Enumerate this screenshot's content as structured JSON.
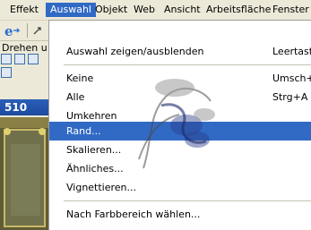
{
  "menubar": {
    "items": [
      {
        "label": "Effekt"
      },
      {
        "label": "Auswahl"
      },
      {
        "label": "Objekt"
      },
      {
        "label": "Web"
      },
      {
        "label": "Ansicht"
      },
      {
        "label": "Arbeitsfläche"
      },
      {
        "label": "Fenster"
      }
    ],
    "active": "Auswahl"
  },
  "toolbar": {
    "drehen_label": "Drehen u",
    "icons": [
      "ie-icon",
      "arrow-icon"
    ]
  },
  "document": {
    "title_fragment": "510"
  },
  "dropdown": {
    "items": [
      {
        "label": "Auswahl zeigen/ausblenden",
        "shortcut": "Leertaste"
      },
      {
        "label": "Keine",
        "shortcut": "Umsch+G"
      },
      {
        "label": "Alle",
        "shortcut": "Strg+A"
      },
      {
        "label": "Umkehren",
        "shortcut": ""
      },
      {
        "label": "Rand...",
        "shortcut": "",
        "highlighted": true
      },
      {
        "label": "Skalieren...",
        "shortcut": ""
      },
      {
        "label": "Ähnliches...",
        "shortcut": ""
      },
      {
        "label": "Vignettieren...",
        "shortcut": ""
      },
      {
        "label": "Nach Farbbereich wählen...",
        "shortcut": ""
      }
    ]
  },
  "colors": {
    "highlight": "#316ac5",
    "menubar_bg": "#ece9d8",
    "titlebar": "#1d4aa0"
  }
}
